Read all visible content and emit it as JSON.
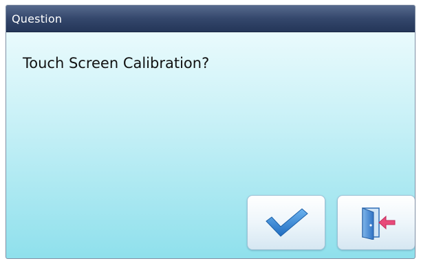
{
  "dialog": {
    "title": "Question",
    "message": "Touch Screen Calibration?"
  },
  "buttons": {
    "confirm_icon": "checkmark-icon",
    "exit_icon": "exit-door-icon"
  },
  "colors": {
    "titlebar": "#34476c",
    "checkmark": "#2f7fd0",
    "door": "#3a7fcf",
    "arrow": "#e84a7a"
  }
}
